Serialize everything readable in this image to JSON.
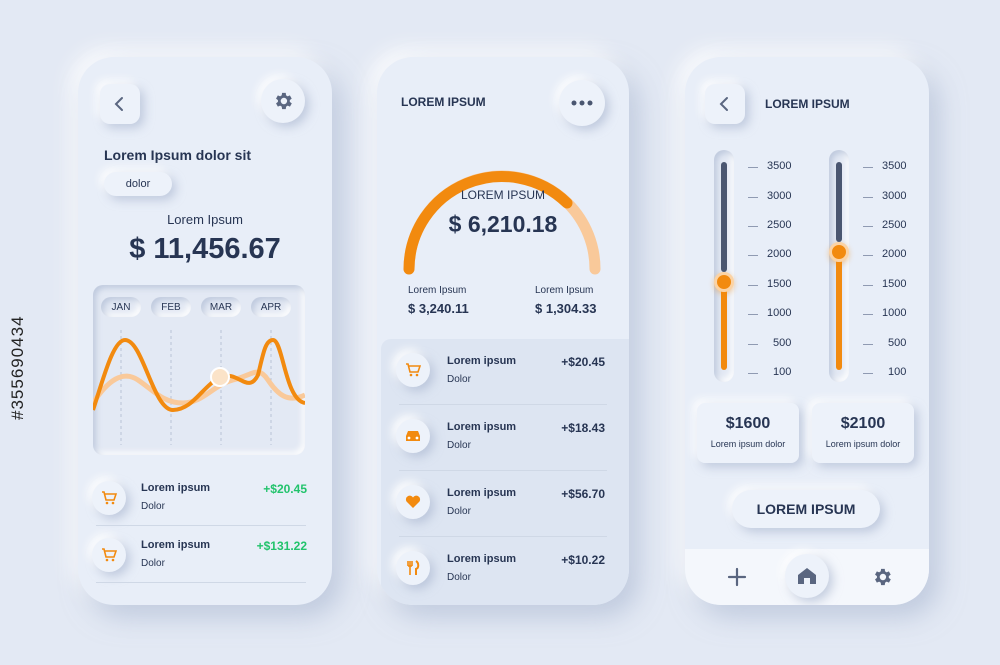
{
  "colors": {
    "background": "#e3e9f4",
    "accent": "#f28a0f",
    "accent_light": "#f9c99a",
    "green": "#22c36c",
    "text": "#273553"
  },
  "phone1": {
    "title": "Lorem Ipsum dolor sit",
    "chip": "dolor",
    "subtitle": "Lorem Ipsum",
    "balance": "$ 11,456.67",
    "months": [
      "JAN",
      "FEB",
      "MAR",
      "APR"
    ],
    "transactions": [
      {
        "icon": "cart-icon",
        "title": "Lorem ipsum",
        "sub": "Dolor",
        "amount": "+$20.45"
      },
      {
        "icon": "cart-icon",
        "title": "Lorem ipsum",
        "sub": "Dolor",
        "amount": "+$131.22"
      }
    ]
  },
  "phone2": {
    "header": "LOREM IPSUM",
    "gauge_label": "LOREM IPSUM",
    "gauge_value": "$ 6,210.18",
    "stats": [
      {
        "label": "Lorem Ipsum",
        "value": "$ 3,240.11"
      },
      {
        "label": "Lorem Ipsum",
        "value": "$ 1,304.33"
      }
    ],
    "transactions": [
      {
        "icon": "cart-icon",
        "title": "Lorem ipsum",
        "sub": "Dolor",
        "amount": "+$20.45"
      },
      {
        "icon": "car-icon",
        "title": "Lorem ipsum",
        "sub": "Dolor",
        "amount": "+$18.43"
      },
      {
        "icon": "heart-icon",
        "title": "Lorem ipsum",
        "sub": "Dolor",
        "amount": "+$56.70"
      },
      {
        "icon": "food-icon",
        "title": "Lorem ipsum",
        "sub": "Dolor",
        "amount": "+$10.22"
      }
    ]
  },
  "phone3": {
    "header": "LOREM IPSUM",
    "scale": [
      "3500",
      "3000",
      "2500",
      "2000",
      "1500",
      "1000",
      "500",
      "100"
    ],
    "sliders": [
      1600,
      2100
    ],
    "cards": [
      {
        "value": "$1600",
        "label": "Lorem ipsum dolor"
      },
      {
        "value": "$2100",
        "label": "Lorem ipsum dolor"
      }
    ],
    "cta": "LOREM IPSUM",
    "nav": [
      "plus-icon",
      "home-icon",
      "gear-icon"
    ]
  },
  "watermark": "#355690434"
}
